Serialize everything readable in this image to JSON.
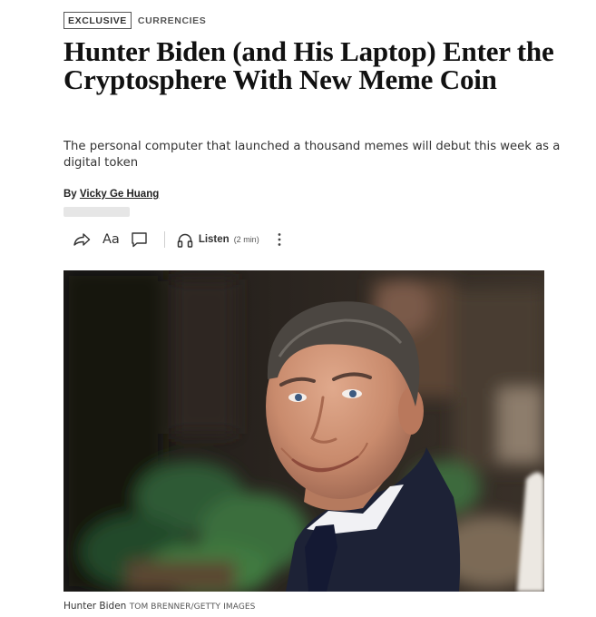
{
  "tags": {
    "exclusive": "EXCLUSIVE",
    "category": "CURRENCIES"
  },
  "article": {
    "headline": "Hunter Biden (and His Laptop) Enter the Cryptosphere With New Meme Coin",
    "dek": "The personal computer that launched a thousand memes will debut this week as a digital token",
    "byline_prefix": "By",
    "author": "Vicky Ge Huang"
  },
  "toolbar": {
    "text_size_label": "Aa",
    "listen_label": "Listen",
    "listen_duration": "(2 min)",
    "icons": [
      "share-icon",
      "text-size-icon",
      "comment-icon",
      "headphones-icon",
      "more-icon"
    ]
  },
  "image": {
    "caption": "Hunter Biden",
    "credit": "TOM BRENNER/GETTY IMAGES"
  }
}
